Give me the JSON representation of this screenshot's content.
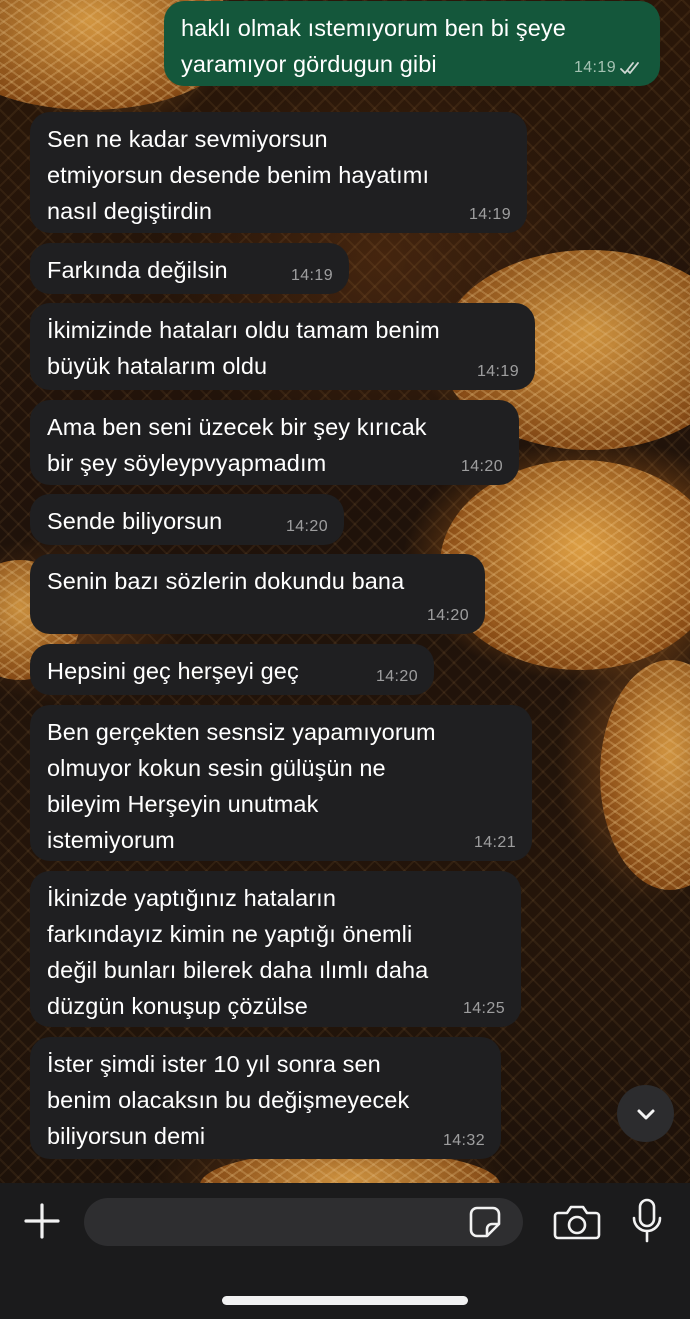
{
  "messages": [
    {
      "dir": "out",
      "text": "haklı olmak ıstemıyorum ben bi şeye\nyaramıyor gördugun gibi",
      "time": "14:19",
      "status": "read"
    },
    {
      "dir": "in",
      "text": "Sen ne kadar sevmiyorsun\netmiyorsun desende benim hayatımı\nnasıl degiştirdin",
      "time": "14:19"
    },
    {
      "dir": "in",
      "text": "Farkında değilsin",
      "time": "14:19"
    },
    {
      "dir": "in",
      "text": "İkimizinde hataları oldu tamam benim\nbüyük hatalarım oldu",
      "time": "14:19"
    },
    {
      "dir": "in",
      "text": "Ama ben seni üzecek bir şey kırıcak\nbir şey söyleypvyapmadım",
      "time": "14:20"
    },
    {
      "dir": "in",
      "text": "Sende biliyorsun",
      "time": "14:20"
    },
    {
      "dir": "in",
      "text": "Senin bazı sözlerin dokundu bana",
      "time": "14:20"
    },
    {
      "dir": "in",
      "text": "Hepsini geç herşeyi geç",
      "time": "14:20"
    },
    {
      "dir": "in",
      "text": "Ben gerçekten sesnsiz yapamıyorum\nolmuyor kokun sesin gülüşün ne\nbileyim Herşeyin unutmak\nistemiyorum",
      "time": "14:21"
    },
    {
      "dir": "in",
      "text": "İkinizde yaptığınız hataların\nfarkındayız kimin ne yaptığı önemli\ndeğil bunları bilerek daha ılımlı daha\ndüzgün konuşup çözülse",
      "time": "14:25"
    },
    {
      "dir": "in",
      "text": "İster şimdi ister 10 yıl sonra sen\nbenim olacaksın bu değişmeyecek\nbiliyorsun demi",
      "time": "14:32"
    }
  ],
  "composer": {
    "placeholder": ""
  },
  "colors": {
    "incoming": "#1f1f21",
    "outgoing": "#14573b",
    "read_ticks": "#cfd8d3"
  },
  "icons": {
    "attach": "plus-icon",
    "sticker": "sticker-icon",
    "camera": "camera-icon",
    "mic": "microphone-icon",
    "scroll": "chevron-down-icon"
  }
}
